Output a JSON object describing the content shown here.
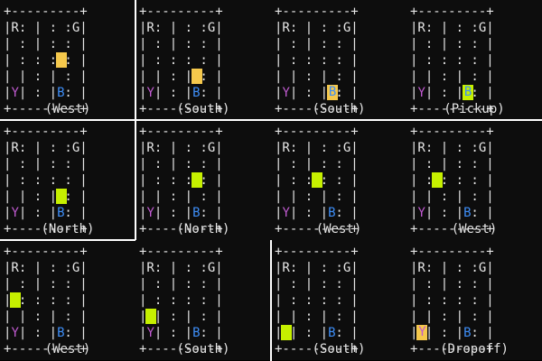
{
  "colors": {
    "taxi_empty": "#f5c84c",
    "taxi_loaded": "#c6f000",
    "loc_R": "#e6e6e6",
    "loc_G": "#e6e6e6",
    "loc_Y_passenger": "#c05ad0",
    "loc_B_destination": "#3e8ef7"
  },
  "board_template": [
    "+---------+",
    "|R: | : :G|",
    "| : | : : |",
    "| : : : : |",
    "| | : | : |",
    "|Y| : |B: |",
    "+---------+"
  ],
  "frames": [
    {
      "caption": "(West)",
      "taxi_row": 2,
      "taxi_col": 3,
      "loaded": false,
      "passenger_at": "Y",
      "destination": "B"
    },
    {
      "caption": "(South)",
      "taxi_row": 3,
      "taxi_col": 3,
      "loaded": false,
      "passenger_at": "Y",
      "destination": "B"
    },
    {
      "caption": "(South)",
      "taxi_row": 4,
      "taxi_col": 3,
      "loaded": false,
      "passenger_at": "Y",
      "destination": "B"
    },
    {
      "caption": "(Pickup)",
      "taxi_row": 4,
      "taxi_col": 3,
      "loaded": true,
      "passenger_at": "Y",
      "destination": "B"
    },
    {
      "caption": "(North)",
      "taxi_row": 3,
      "taxi_col": 3,
      "loaded": true,
      "passenger_at": "Y",
      "destination": "B"
    },
    {
      "caption": "(North)",
      "taxi_row": 2,
      "taxi_col": 3,
      "loaded": true,
      "passenger_at": "Y",
      "destination": "B"
    },
    {
      "caption": "(West)",
      "taxi_row": 2,
      "taxi_col": 2,
      "loaded": true,
      "passenger_at": "Y",
      "destination": "B"
    },
    {
      "caption": "(West)",
      "taxi_row": 2,
      "taxi_col": 1,
      "loaded": true,
      "passenger_at": "Y",
      "destination": "B"
    },
    {
      "caption": "(West)",
      "taxi_row": 2,
      "taxi_col": 0,
      "loaded": true,
      "passenger_at": "Y",
      "destination": "B"
    },
    {
      "caption": "(South)",
      "taxi_row": 3,
      "taxi_col": 0,
      "loaded": true,
      "passenger_at": "Y",
      "destination": "B"
    },
    {
      "caption": "(South)",
      "taxi_row": 4,
      "taxi_col": 0,
      "loaded": true,
      "passenger_at": "Y",
      "destination": "B"
    },
    {
      "caption": "(Dropoff)",
      "taxi_row": 4,
      "taxi_col": 0,
      "loaded": false,
      "passenger_at": "Y",
      "destination": "B"
    }
  ]
}
